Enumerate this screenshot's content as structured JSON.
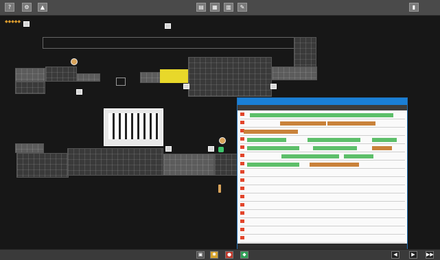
{
  "colors": {
    "green": "#5dbf6a",
    "orange": "#c9823a",
    "yellow": "#e8d82a",
    "accent": "#1a7fd6",
    "red": "#e2462c"
  },
  "toolbar": {
    "left": [
      "?",
      "⚙",
      "▲"
    ],
    "center": [
      "▤",
      "▦",
      "▥",
      "✎"
    ],
    "right": [
      "▮"
    ]
  },
  "canvas": {
    "status_label": "◆◆◆◆◆"
  },
  "timeline": {
    "title": "",
    "tabs": [
      "",
      "",
      ""
    ],
    "rows": [
      {
        "bars": [
          {
            "s": 0.06,
            "e": 0.93,
            "c": "green"
          }
        ]
      },
      {
        "bars": [
          {
            "s": 0.24,
            "e": 0.52,
            "c": "orange"
          },
          {
            "s": 0.53,
            "e": 0.82,
            "c": "orange"
          }
        ]
      },
      {
        "bars": [
          {
            "s": 0.02,
            "e": 0.35,
            "c": "orange"
          }
        ]
      },
      {
        "bars": [
          {
            "s": 0.04,
            "e": 0.28,
            "c": "green"
          },
          {
            "s": 0.41,
            "e": 0.73,
            "c": "green"
          },
          {
            "s": 0.8,
            "e": 0.95,
            "c": "green"
          }
        ]
      },
      {
        "bars": [
          {
            "s": 0.04,
            "e": 0.36,
            "c": "green"
          },
          {
            "s": 0.44,
            "e": 0.71,
            "c": "green"
          },
          {
            "s": 0.8,
            "e": 0.92,
            "c": "orange"
          }
        ]
      },
      {
        "bars": [
          {
            "s": 0.25,
            "e": 0.6,
            "c": "green"
          },
          {
            "s": 0.63,
            "e": 0.81,
            "c": "green"
          }
        ]
      },
      {
        "bars": [
          {
            "s": 0.04,
            "e": 0.36,
            "c": "green"
          },
          {
            "s": 0.42,
            "e": 0.72,
            "c": "orange"
          }
        ]
      },
      {
        "bars": []
      },
      {
        "bars": []
      },
      {
        "bars": []
      },
      {
        "bars": []
      },
      {
        "bars": []
      },
      {
        "bars": []
      },
      {
        "bars": []
      },
      {
        "bars": []
      },
      {
        "bars": []
      }
    ]
  },
  "bottombar": {
    "buttons": [
      "▣",
      "✱",
      "●",
      "◆"
    ],
    "right": [
      "◀",
      "▶",
      "▶▶"
    ]
  }
}
